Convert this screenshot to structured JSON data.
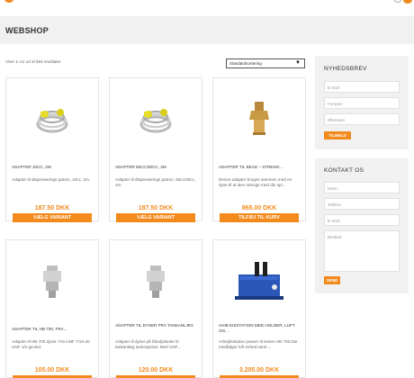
{
  "header": {
    "page_title": "WEBSHOP"
  },
  "shop": {
    "result_count": "Viser 1–12 ud af 593 resultater",
    "sort_selected": "Standardsortering"
  },
  "products": [
    {
      "name": "ADAPTER 10CC, 2M",
      "desc": "Adapter til dispenserings patron, 10cc, 2m.",
      "price": "187.50 DKK",
      "button": "VÆLG VARIANT"
    },
    {
      "name": "ADAPTER 55CC/30CC, 2M",
      "desc": "Adapter til dispenserings patron, 55cc/30cc, 2m.",
      "price": "187.50 DKK",
      "button": "VÆLG VARIANT"
    },
    {
      "name": "ADAPTER TIL BEAD – STRENG...",
      "desc": "Denne adapter bruges sammen med en dyse til at lave strenge med din spr...",
      "price": "865.00 DKK",
      "button": "TILFØJ TIL KURV"
    },
    {
      "name": "ADAPTER TIL HB 700, FRA...",
      "desc": "Adapter til HB 700 dyser. Fra UNF 7/16-20 UNF 1/2 gevind.",
      "price": "105.00 DKK",
      "button": ""
    },
    {
      "name": "ADAPTER TIL DYSER FRA TANKANLÆG",
      "desc": "Adapter til dyser på håndpistoler til tankanlæg tankssytmer. Med UNF...",
      "price": "120.00 DKK",
      "button": ""
    },
    {
      "name": "AHIB EISSTATION MED HOLDER, LUFT OG...",
      "desc": "Arbejdsstation passer til serien HB 700.Der medfølger luft enhed samt ...",
      "price": "3.205.00 DKK",
      "button": ""
    }
  ],
  "newsletter": {
    "title": "NYHEDSBREV",
    "email_placeholder": "E-mail",
    "firstname_placeholder": "Fornavn",
    "lastname_placeholder": "Efternavn",
    "button": "TILMELD"
  },
  "contact": {
    "title": "KONTAKT OS",
    "name_placeholder": "Navn:",
    "phone_placeholder": "Telefon:",
    "email_placeholder": "E-mail:",
    "message_placeholder": "Besked:",
    "button": "SEND"
  },
  "colors": {
    "accent": "#f28a1d",
    "panel": "#f1f1f1"
  }
}
